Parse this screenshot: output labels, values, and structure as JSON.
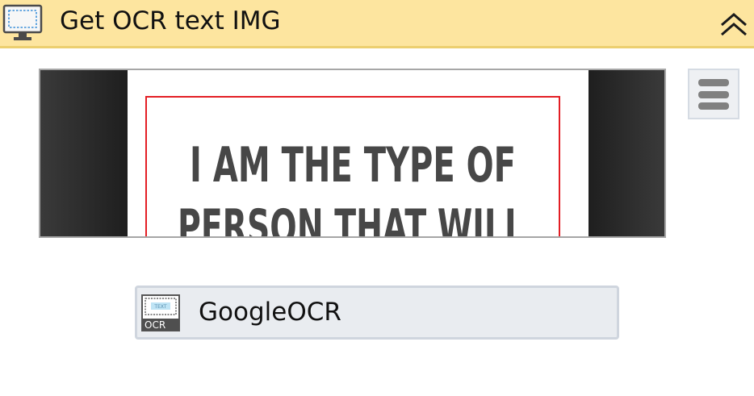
{
  "header": {
    "title": "Get OCR text IMG",
    "icon": "monitor-icon",
    "collapse_icon": "double-chevron-up-icon",
    "background_color": "#fde59f"
  },
  "preview": {
    "lines": [
      "I AM THE TYPE OF",
      "PERSON THAT WILL"
    ],
    "frame_color": "#e31e24",
    "menu_icon": "hamburger-menu-icon"
  },
  "engine": {
    "label": "GoogleOCR",
    "icon": "ocr-icon",
    "icon_badge": "OCR",
    "icon_inner_text": "TEXT"
  }
}
